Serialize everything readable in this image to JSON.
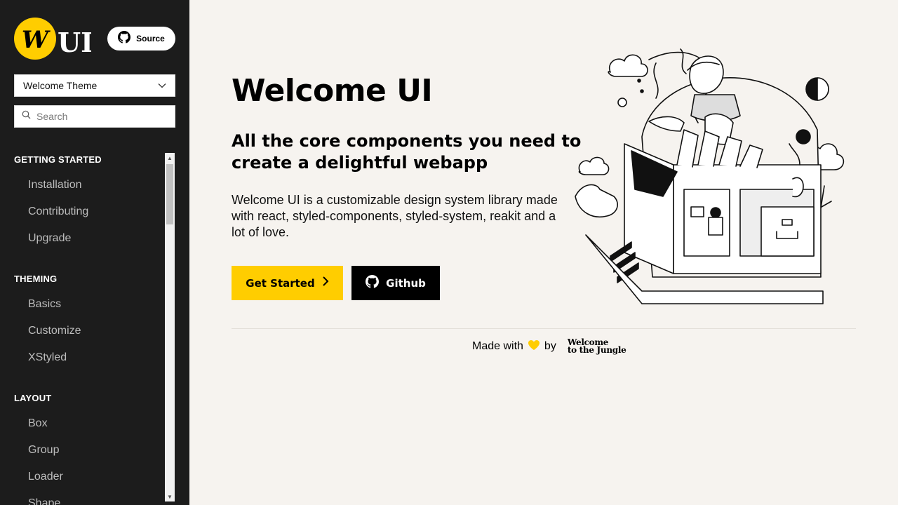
{
  "sidebar": {
    "logo_text": "UI",
    "source_label": "Source",
    "theme_select_value": "Welcome Theme",
    "search_placeholder": "Search",
    "sections": [
      {
        "title": "GETTING STARTED",
        "items": [
          "Installation",
          "Contributing",
          "Upgrade"
        ]
      },
      {
        "title": "THEMING",
        "items": [
          "Basics",
          "Customize",
          "XStyled"
        ]
      },
      {
        "title": "LAYOUT",
        "items": [
          "Box",
          "Group",
          "Loader",
          "Shape"
        ]
      }
    ]
  },
  "main": {
    "title": "Welcome UI",
    "subtitle": "All the core components you need to create a delightful webapp",
    "description": "Welcome UI is a customizable design system library made with react, styled-components, styled-system, reakit and a lot of love.",
    "get_started_label": "Get Started",
    "github_label": "Github"
  },
  "footer": {
    "made_with": "Made with",
    "by": "by",
    "brand_line1": "Welcome",
    "brand_line2": "to the Jungle"
  },
  "colors": {
    "sidebar_bg": "#1c1c1c",
    "page_bg": "#f6f3ef",
    "accent": "#ffcd00",
    "text": "#000000"
  },
  "icons": [
    "github-icon",
    "chevron-down-icon",
    "search-icon",
    "chevron-right-icon",
    "heart-icon",
    "scroll-up-icon",
    "scroll-down-icon"
  ]
}
